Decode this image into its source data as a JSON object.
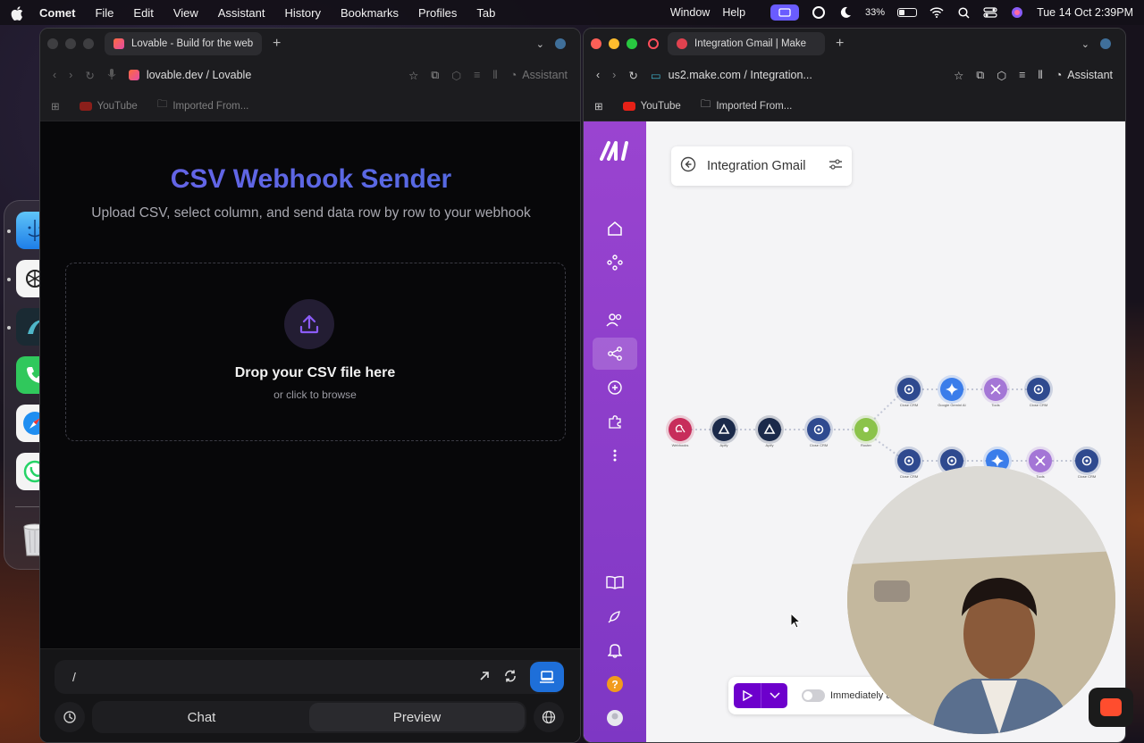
{
  "menubar": {
    "app_name": "Comet",
    "items": [
      "File",
      "Edit",
      "View",
      "Assistant",
      "History",
      "Bookmarks",
      "Profiles",
      "Tab"
    ],
    "right_items": [
      "Window",
      "Help"
    ],
    "battery": "33%",
    "datetime": "Tue 14 Oct  2:39PM"
  },
  "left_window": {
    "tab_title": "Lovable - Build for the web",
    "url": "lovable.dev / Lovable",
    "assistant_label": "Assistant",
    "bookmarks": [
      "YouTube",
      "Imported From..."
    ],
    "page": {
      "title": "CSV Webhook Sender",
      "subtitle": "Upload CSV, select column, and send data row by row to your webhook",
      "dropzone_title": "Drop your CSV file here",
      "dropzone_sub": "or click to browse",
      "title_colors": [
        "#6a62e8",
        "#4f6be0"
      ]
    },
    "prompt_value": "/",
    "modes": [
      "Chat",
      "Preview"
    ]
  },
  "right_window": {
    "tab_title": "Integration Gmail | Make",
    "url": "us2.make.com / Integration...",
    "assistant_label": "Assistant",
    "bookmarks": [
      "YouTube",
      "Imported From..."
    ],
    "scenario_name": "Integration Gmail",
    "run_option_label": "Immediately a",
    "nodes": [
      {
        "name": "Webhooks",
        "icon": "webhook-icon",
        "color": "#c72d5b"
      },
      {
        "name": "Apify",
        "icon": "apify-icon",
        "color": "#1b2a4a"
      },
      {
        "name": "Apify",
        "icon": "apify-icon",
        "color": "#1b2a4a"
      },
      {
        "name": "Close CRM",
        "icon": "gear-icon",
        "color": "#2f4a8f"
      },
      {
        "name": "Router",
        "icon": "router-icon",
        "color": "#8bc34a"
      },
      {
        "name": "Close CRM",
        "icon": "gear-icon",
        "color": "#2f4a8f"
      },
      {
        "name": "Google Gemini AI",
        "icon": "sparkle-icon",
        "color": "#3b7dea"
      },
      {
        "name": "Tools",
        "icon": "tools-icon",
        "color": "#a476d6"
      },
      {
        "name": "Close CRM",
        "icon": "gear-icon",
        "color": "#2f4a8f"
      },
      {
        "name": "Close CRM",
        "icon": "gear-icon",
        "color": "#2f4a8f"
      },
      {
        "name": "Close CRM",
        "icon": "gear-icon",
        "color": "#2f4a8f"
      },
      {
        "name": "Google Gemini AI",
        "icon": "sparkle-icon",
        "color": "#3b7dea"
      },
      {
        "name": "Tools",
        "icon": "tools-icon",
        "color": "#a476d6"
      },
      {
        "name": "Close CRM",
        "icon": "gear-icon",
        "color": "#2f4a8f"
      }
    ]
  },
  "dock": [
    "Finder",
    "ChatGPT",
    "Comet",
    "Phone",
    "Safari",
    "WhatsApp",
    "Trash"
  ]
}
